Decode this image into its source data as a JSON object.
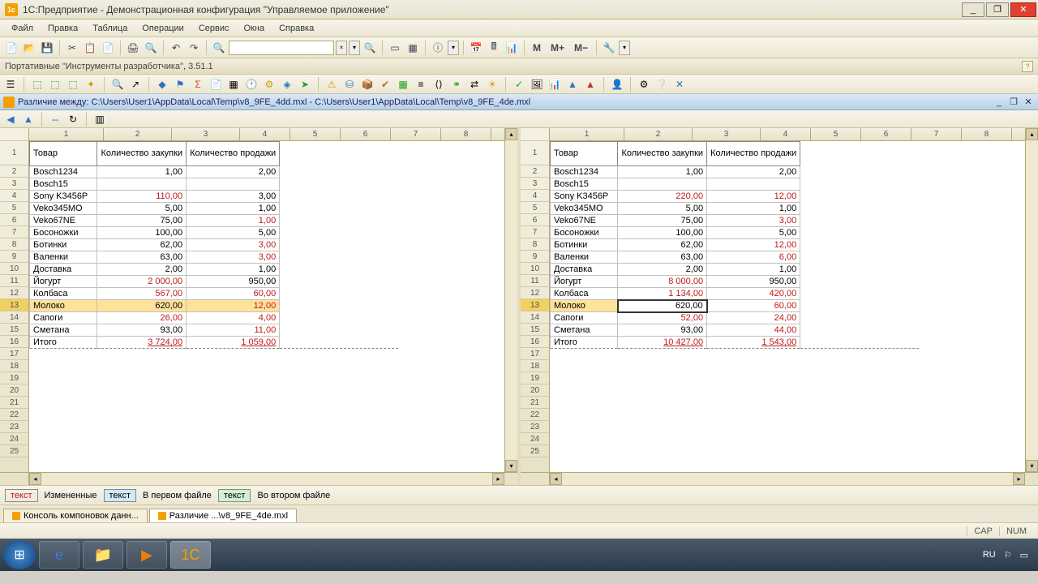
{
  "window": {
    "title": "1С:Предприятие - Демонстрационная конфигурация \"Управляемое приложение\""
  },
  "menu": {
    "file": "Файл",
    "edit": "Правка",
    "table": "Таблица",
    "operations": "Операции",
    "service": "Сервис",
    "windows": "Окна",
    "help": "Справка"
  },
  "tb": {
    "m": "M",
    "mp": "M+",
    "mm": "M−"
  },
  "portbar": {
    "text": "Портативные \"Инструменты разработчика\", 3.51.1"
  },
  "doc": {
    "title": "Различие между: C:\\Users\\User1\\AppData\\Local\\Temp\\v8_9FE_4dd.mxl - C:\\Users\\User1\\AppData\\Local\\Temp\\v8_9FE_4de.mxl"
  },
  "headers": {
    "c1": "Товар",
    "c2": "Количество закупки",
    "c3": "Количество продажи"
  },
  "cols": [
    "1",
    "2",
    "3",
    "4",
    "5",
    "6",
    "7",
    "8"
  ],
  "left": {
    "rows": [
      {
        "n": "2",
        "a": "Bosch1234",
        "b": "1,00",
        "c": "2,00"
      },
      {
        "n": "3",
        "a": "Bosch15",
        "b": "",
        "c": ""
      },
      {
        "n": "4",
        "a": "Sony K3456P",
        "b": "110,00",
        "c": "3,00",
        "db": true
      },
      {
        "n": "5",
        "a": "Veko345MO",
        "b": "5,00",
        "c": "1,00"
      },
      {
        "n": "6",
        "a": "Veko67NE",
        "b": "75,00",
        "c": "1,00",
        "dc": true
      },
      {
        "n": "7",
        "a": "Босоножки",
        "b": "100,00",
        "c": "5,00"
      },
      {
        "n": "8",
        "a": "Ботинки",
        "b": "62,00",
        "c": "3,00",
        "dc": true
      },
      {
        "n": "9",
        "a": "Валенки",
        "b": "63,00",
        "c": "3,00",
        "dc": true
      },
      {
        "n": "10",
        "a": "Доставка",
        "b": "2,00",
        "c": "1,00"
      },
      {
        "n": "11",
        "a": "Йогурт",
        "b": "2 000,00",
        "c": "950,00",
        "db": true
      },
      {
        "n": "12",
        "a": "Колбаса",
        "b": "567,00",
        "c": "60,00",
        "db": true,
        "dc": true
      },
      {
        "n": "13",
        "a": "Молоко",
        "b": "620,00",
        "c": "12,00",
        "dc": true,
        "sel": true
      },
      {
        "n": "14",
        "a": "Сапоги",
        "b": "26,00",
        "c": "4,00",
        "db": true,
        "dc": true
      },
      {
        "n": "15",
        "a": "Сметана",
        "b": "93,00",
        "c": "11,00",
        "dc": true
      },
      {
        "n": "16",
        "a": "Итого",
        "b": "3 724,00",
        "c": "1 059,00",
        "db": true,
        "dc": true,
        "total": true
      }
    ]
  },
  "right": {
    "rows": [
      {
        "n": "2",
        "a": "Bosch1234",
        "b": "1,00",
        "c": "2,00"
      },
      {
        "n": "3",
        "a": "Bosch15",
        "b": "",
        "c": ""
      },
      {
        "n": "4",
        "a": "Sony K3456P",
        "b": "220,00",
        "c": "12,00",
        "db": true,
        "dc": true
      },
      {
        "n": "5",
        "a": "Veko345MO",
        "b": "5,00",
        "c": "1,00"
      },
      {
        "n": "6",
        "a": "Veko67NE",
        "b": "75,00",
        "c": "3,00",
        "dc": true
      },
      {
        "n": "7",
        "a": "Босоножки",
        "b": "100,00",
        "c": "5,00"
      },
      {
        "n": "8",
        "a": "Ботинки",
        "b": "62,00",
        "c": "12,00",
        "dc": true
      },
      {
        "n": "9",
        "a": "Валенки",
        "b": "63,00",
        "c": "6,00",
        "dc": true
      },
      {
        "n": "10",
        "a": "Доставка",
        "b": "2,00",
        "c": "1,00"
      },
      {
        "n": "11",
        "a": "Йогурт",
        "b": "8 000,00",
        "c": "950,00",
        "db": true
      },
      {
        "n": "12",
        "a": "Колбаса",
        "b": "1 134,00",
        "c": "420,00",
        "db": true,
        "dc": true
      },
      {
        "n": "13",
        "a": "Молоко",
        "b": "620,00",
        "c": "60,00",
        "dc": true,
        "sel": true,
        "selcell": "b"
      },
      {
        "n": "14",
        "a": "Сапоги",
        "b": "52,00",
        "c": "24,00",
        "db": true,
        "dc": true
      },
      {
        "n": "15",
        "a": "Сметана",
        "b": "93,00",
        "c": "44,00",
        "dc": true
      },
      {
        "n": "16",
        "a": "Итого",
        "b": "10 427,00",
        "c": "1 543,00",
        "db": true,
        "dc": true,
        "total": true
      }
    ]
  },
  "legend": {
    "l1_box": "текст",
    "l1": "Измененные",
    "l2_box": "текст",
    "l2": "В первом файле",
    "l3_box": "текст",
    "l3": "Во втором файле"
  },
  "tabs": {
    "t1": "Консоль компоновок данн...",
    "t2": "Различие ...\\v8_9FE_4de.mxl"
  },
  "status": {
    "cap": "CAP",
    "num": "NUM"
  },
  "tray": {
    "lang": "RU"
  },
  "extra_rows": [
    "17",
    "18",
    "19",
    "20",
    "21",
    "22",
    "23",
    "24",
    "25"
  ]
}
